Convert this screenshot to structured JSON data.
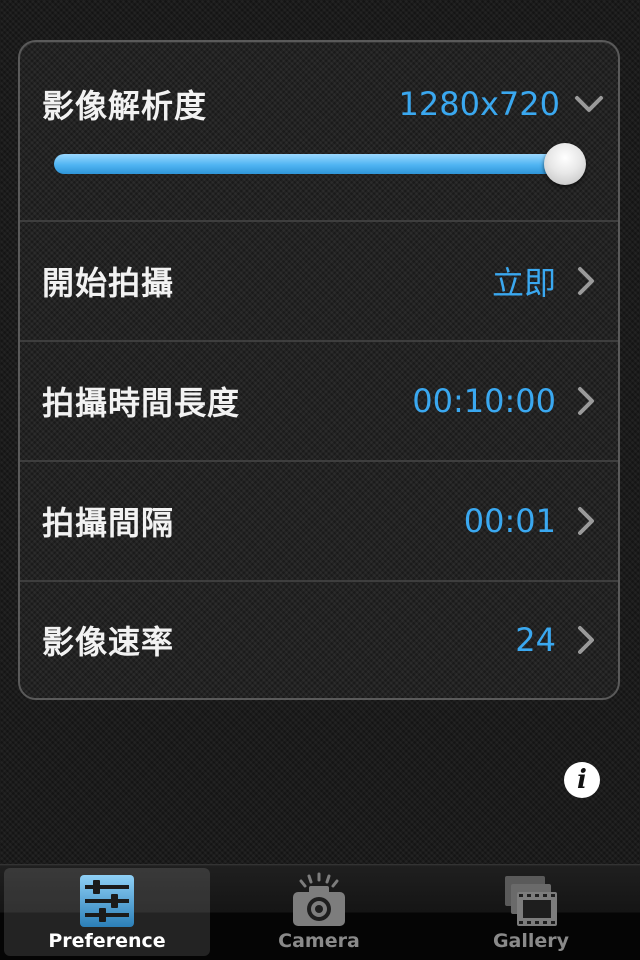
{
  "settings": {
    "resolution": {
      "label": "影像解析度",
      "value": "1280x720",
      "slider_level": 1.0,
      "icon": "chevron-down-icon"
    },
    "start_capture": {
      "label": "開始拍攝",
      "value": "立即",
      "icon": "chevron-right-icon"
    },
    "capture_duration": {
      "label": "拍攝時間長度",
      "value": "00:10:00",
      "icon": "chevron-right-icon"
    },
    "capture_interval": {
      "label": "拍攝間隔",
      "value": "00:01",
      "icon": "chevron-right-icon"
    },
    "frame_rate": {
      "label": "影像速率",
      "value": "24",
      "icon": "chevron-right-icon"
    }
  },
  "info_button": {
    "icon": "info-icon",
    "glyph": "i"
  },
  "tabbar": {
    "tabs": [
      {
        "label": "Preference",
        "icon": "sliders-icon",
        "active": true
      },
      {
        "label": "Camera",
        "icon": "camera-icon",
        "active": false
      },
      {
        "label": "Gallery",
        "icon": "film-strip-icon",
        "active": false
      }
    ]
  },
  "colors": {
    "accent": "#3aa8f0",
    "slider_fill": "#4fb4f2",
    "label_text": "#f2f2f2",
    "tab_active_text": "#ffffff",
    "tab_inactive_text": "#8a8a8a"
  }
}
